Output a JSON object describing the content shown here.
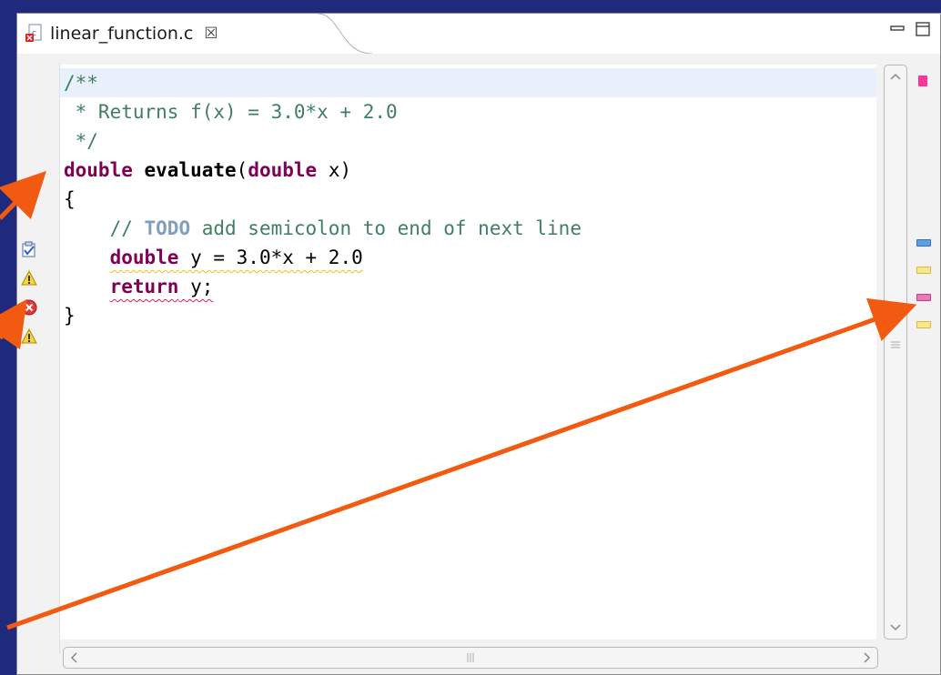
{
  "tab": {
    "filename": "linear_function.c",
    "close_glyph": "☒"
  },
  "code": {
    "lines": [
      "/**",
      " * Returns f(x) = 3.0*x + 2.0",
      " */",
      "double evaluate(double x)",
      "{",
      "    // TODO add semicolon to end of next line",
      "    double y = 3.0*x + 2.0",
      "    return y;",
      "}"
    ],
    "tokens": {
      "l1": "/**",
      "l2": " * Returns f(x) = 3.0*x + 2.0",
      "l3": " */",
      "l4_kw1": "double",
      "l4_fn": " evaluate",
      "l4_p1": "(",
      "l4_kw2": "double",
      "l4_p2": " x)",
      "l5": "{",
      "l6_a": "    // ",
      "l6_todo": "TODO",
      "l6_b": " add semicolon to end of next line",
      "l7_ind": "    ",
      "l7_kw": "double",
      "l7_rest": " y = 3.0*x + 2.0",
      "l8_ind": "    ",
      "l8_kw": "return",
      "l8_rest": " y;",
      "l9": "}"
    }
  },
  "gutter_markers": [
    {
      "line": 6,
      "icon": "task-icon"
    },
    {
      "line": 7,
      "icon": "warning-icon"
    },
    {
      "line": 8,
      "icon": "error-icon"
    },
    {
      "line": 9,
      "icon": "warning-icon"
    }
  ],
  "overview_markers": [
    {
      "type": "error-summary",
      "color": "#ff3399"
    },
    {
      "type": "task",
      "color": "#4a90e2"
    },
    {
      "type": "warning",
      "color": "#f7e07a"
    },
    {
      "type": "error",
      "color": "#ee66aa"
    },
    {
      "type": "warning",
      "color": "#f7e07a"
    }
  ],
  "colors": {
    "background": "#1f2a7c",
    "arrow": "#f25a12",
    "keyword": "#7f0055",
    "comment": "#3f7f5f",
    "current_line": "#e8f0fb"
  }
}
